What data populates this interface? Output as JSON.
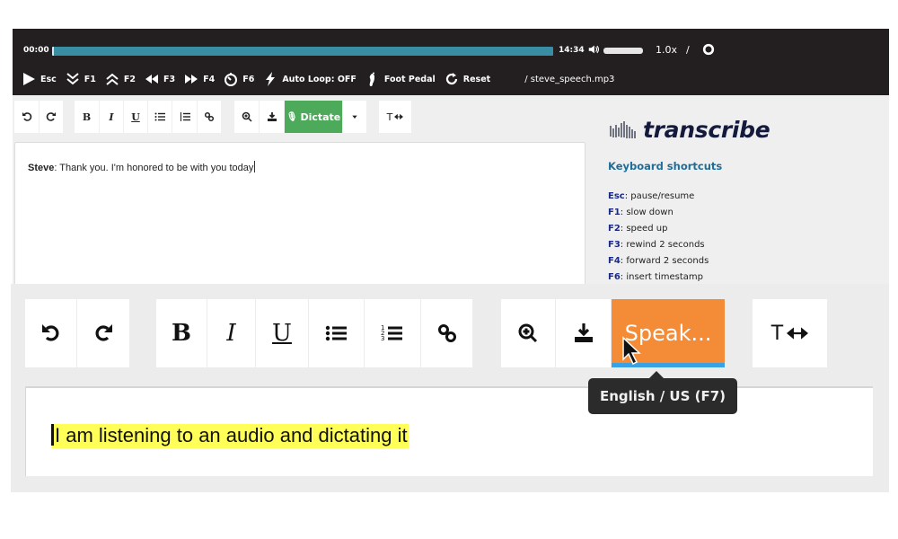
{
  "player": {
    "current_time": "00:00",
    "total_time": "14:34",
    "progress_fraction": 0.0,
    "volume_fraction": 1.0,
    "speed": "1.0x",
    "speed_separator": "/",
    "filename": "/ steve_speech.mp3",
    "controls": [
      {
        "icon": "play-icon",
        "label": "Esc"
      },
      {
        "icon": "double-chevron-down-icon",
        "label": "F1"
      },
      {
        "icon": "double-chevron-up-icon",
        "label": "F2"
      },
      {
        "icon": "rewind-icon",
        "label": "F3"
      },
      {
        "icon": "fast-forward-icon",
        "label": "F4"
      },
      {
        "icon": "timer-icon",
        "label": "F6"
      },
      {
        "icon": "lightning-icon",
        "label": "Auto Loop: OFF"
      },
      {
        "icon": "foot-icon",
        "label": "Foot Pedal"
      },
      {
        "icon": "reset-icon",
        "label": "Reset"
      }
    ]
  },
  "toolbar": {
    "buttons": [
      "undo",
      "redo",
      "bold",
      "italic",
      "underline",
      "bullet-list",
      "numbered-list",
      "link",
      "zoom-in",
      "download",
      "dictate",
      "dropdown",
      "text-width"
    ],
    "bold_glyph": "B",
    "italic_glyph": "I",
    "underline_glyph": "U",
    "dictate_label": "Dictate",
    "text_width_glyph": "T",
    "dictate_color": "#4caa5a"
  },
  "editor": {
    "speaker": "Steve",
    "text": ": Thank you. I'm honored to be with you today"
  },
  "sidebar": {
    "brand": "transcribe",
    "shortcuts_title": "Keyboard shortcuts",
    "shortcuts": [
      {
        "key": "Esc",
        "action": ": pause/resume"
      },
      {
        "key": "F1",
        "action": ": slow down"
      },
      {
        "key": "F2",
        "action": ": speed up"
      },
      {
        "key": "F3",
        "action": ": rewind 2 seconds"
      },
      {
        "key": "F4",
        "action": ": forward 2 seconds"
      },
      {
        "key": "F6",
        "action": ": insert timestamp"
      }
    ]
  },
  "zoomed": {
    "speak_label": "Speak...",
    "speak_color": "#f48b37",
    "tooltip": "English / US (F7)",
    "dictated_text": "I am listening to an audio and dictating it",
    "bold_glyph": "B",
    "italic_glyph": "I",
    "underline_glyph": "U",
    "text_width_glyph": "T"
  }
}
